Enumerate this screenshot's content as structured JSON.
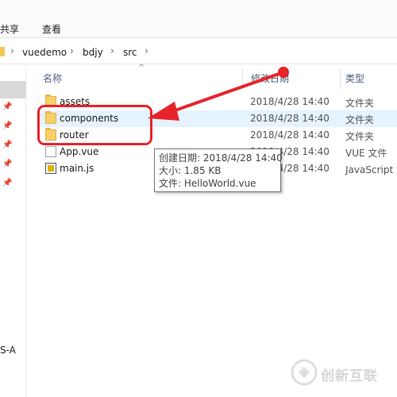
{
  "ribbon": {
    "tabs": [
      "共享",
      "查看"
    ]
  },
  "address": {
    "crumbs": [
      "vuedemo",
      "bdjy",
      "src"
    ],
    "separator": "›"
  },
  "nav": {
    "partial_label": "S-A"
  },
  "columns": {
    "name": "名称",
    "date": "修改日期",
    "type": "类型"
  },
  "rows": [
    {
      "name": "assets",
      "date": "2018/4/28 14:40",
      "type": "文件夹",
      "icon": "folder-icon"
    },
    {
      "name": "components",
      "date": "2018/4/28 14:40",
      "type": "文件夹",
      "icon": "folder-icon"
    },
    {
      "name": "router",
      "date": "2018/4/28 14:40",
      "type": "文件夹",
      "icon": "folder-icon"
    },
    {
      "name": "App.vue",
      "date": "2018/4/28 14:40",
      "type": "VUE 文件",
      "icon": "file-icon"
    },
    {
      "name": "main.js",
      "date": "2018/4/28 14:40",
      "type": "JavaScript 文",
      "icon": "js-file-icon"
    }
  ],
  "tooltip": {
    "line1": "创建日期: 2018/4/28 14:40",
    "line2": "大小: 1.85 KB",
    "line3": "文件: HelloWorld.vue"
  },
  "watermark": {
    "text": "创新互联"
  },
  "colors": {
    "annotation_red": "#e8242b",
    "folder_yellow": "#f7d068",
    "hover_blue": "#e5f3ff"
  }
}
